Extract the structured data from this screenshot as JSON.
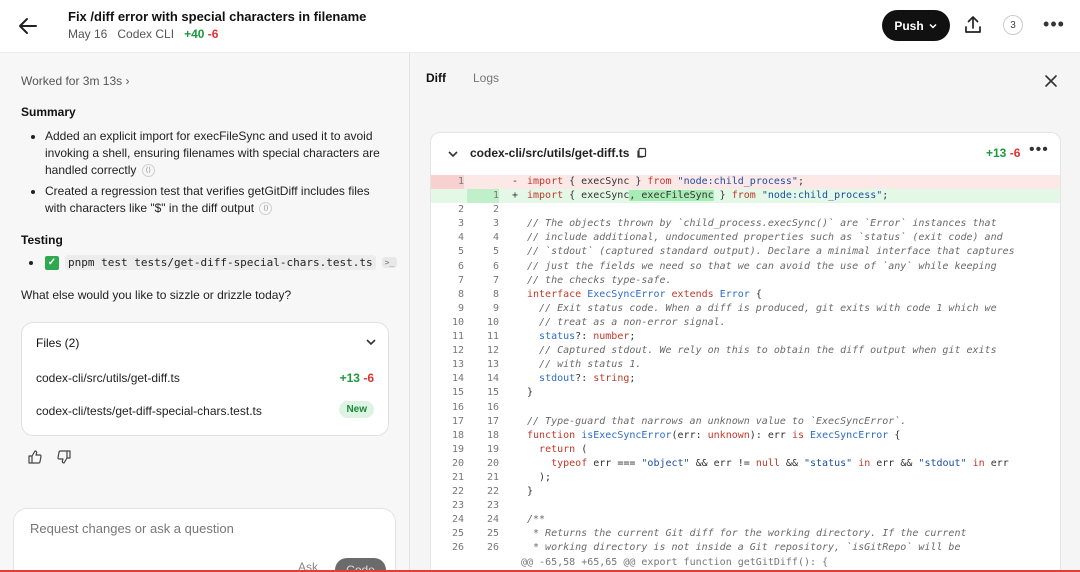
{
  "header": {
    "title": "Fix /diff error with special characters in filename",
    "date": "May 16",
    "app": "Codex CLI",
    "additions": "+40",
    "deletions": "-6",
    "push_label": "Push",
    "count": "3"
  },
  "left": {
    "worked": "Worked for 3m 13s ›",
    "summary_heading": "Summary",
    "summary_items": [
      "Added an explicit import for execFileSync and used it to avoid invoking a shell, ensuring filenames with special characters are handled correctly",
      "Created a regression test that verifies getGitDiff includes files with characters like \"$\" in the diff output"
    ],
    "testing_heading": "Testing",
    "test_command": "pnpm test tests/get-diff-special-chars.test.ts",
    "terminal_badge": ">_",
    "question": "What else would you like to sizzle or drizzle today?",
    "files": {
      "heading": "Files (2)",
      "items": [
        {
          "name": "codex-cli/src/utils/get-diff.ts",
          "plus": "+13",
          "minus": "-6"
        },
        {
          "name": "codex-cli/tests/get-diff-special-chars.test.ts",
          "badge": "New"
        }
      ]
    },
    "composer": {
      "placeholder": "Request changes or ask a question",
      "ask_label": "Ask",
      "code_label": "Code"
    }
  },
  "right": {
    "tabs": [
      "Diff",
      "Logs"
    ],
    "file_path": "codex-cli/src/utils/get-diff.ts",
    "plus": "+13",
    "minus": "-6",
    "hunk_header": "@@ -65,58 +65,65 @@ export function getGitDiff(): {"
  },
  "colors": {
    "accent_green": "#1a9a3c",
    "accent_red": "#d33333",
    "deleted_bg": "#fde8e8",
    "added_bg": "#e4f8e8"
  }
}
